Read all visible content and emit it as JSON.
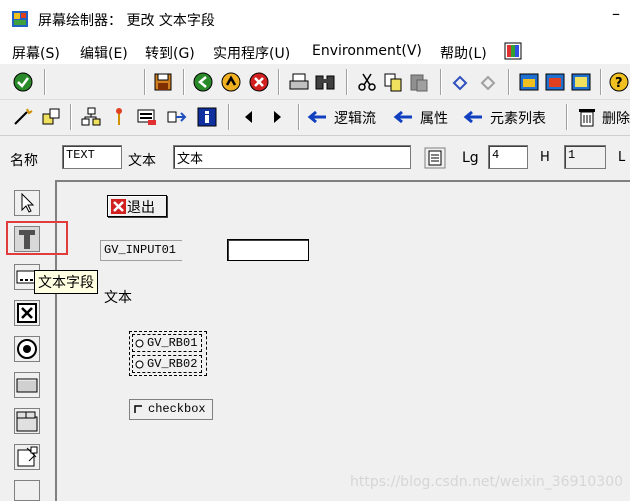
{
  "window": {
    "title": "屏幕绘制器：  更改 文本字段",
    "minimize_glyph": "–"
  },
  "menu": [
    "屏幕(S)",
    "编辑(E)",
    "转到(G)",
    "实用程序(U)",
    "Environment(V)",
    "帮助(L)"
  ],
  "toolbar2": {
    "flow_logic": "逻辑流",
    "attributes": "属性",
    "element_list": "元素列表",
    "delete": "删除"
  },
  "attr_bar": {
    "name_label": "名称",
    "name_value": "TEXT",
    "text_label": "文本",
    "text_value": "文本",
    "lg_label": "Lg",
    "lg_value": "4",
    "h_label": "H",
    "h_value": "1",
    "l_label": "L"
  },
  "palette": {
    "tooltip": "文本字段"
  },
  "canvas": {
    "exit_button": "退出",
    "input_label": "GV_INPUT01",
    "text_field": "文本",
    "radio1": "GV_RB01",
    "radio2": "GV_RB02",
    "checkbox": "checkbox"
  },
  "watermark": "https://blog.csdn.net/weixin_36910300",
  "icons": [
    "app-icon",
    "enter-icon",
    "save-icon",
    "back-icon",
    "exit-icon",
    "cancel-icon",
    "print-icon",
    "find-icon",
    "cut-icon",
    "copy-icon",
    "paste-icon",
    "undo-icon",
    "redo-icon",
    "help-icon",
    "pointer-icon",
    "text-tool-icon",
    "input-tool-icon",
    "checkbox-tool-icon",
    "radio-tool-icon",
    "pushbutton-tool-icon",
    "tabstrip-tool-icon",
    "box-tool-icon"
  ]
}
